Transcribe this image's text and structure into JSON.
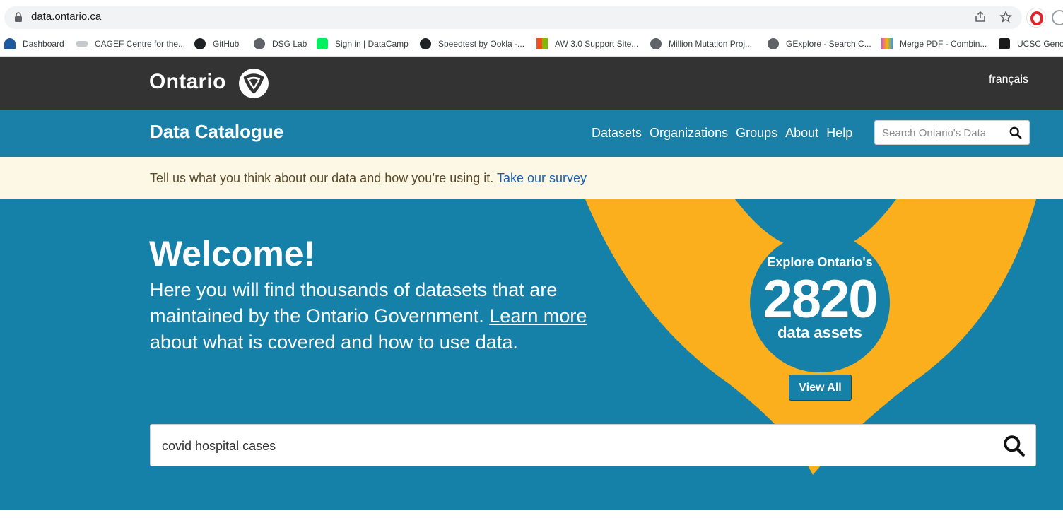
{
  "browser": {
    "url": "data.ontario.ca",
    "bookmarks": [
      {
        "label": "Dashboard",
        "icon": "tree-icon",
        "color": "#1f5b9c"
      },
      {
        "label": "CAGEF Centre for the...",
        "icon": "cagef-icon",
        "color": "#9aa0a6"
      },
      {
        "label": "GitHub",
        "icon": "github-icon",
        "color": "#202124"
      },
      {
        "label": "DSG Lab",
        "icon": "globe-icon",
        "color": "#5f6368"
      },
      {
        "label": "Sign in | DataCamp",
        "icon": "datacamp-icon",
        "color": "#03ef62"
      },
      {
        "label": "Speedtest by Ookla -...",
        "icon": "speedtest-icon",
        "color": "#202124"
      },
      {
        "label": "AW 3.0 Support Site...",
        "icon": "microsoft-icon",
        "color": "#f25022"
      },
      {
        "label": "Million Mutation Proj...",
        "icon": "globe-icon",
        "color": "#5f6368"
      },
      {
        "label": "GExplore - Search C...",
        "icon": "globe-icon",
        "color": "#5f6368"
      },
      {
        "label": "Merge PDF - Combin...",
        "icon": "pdf-icon",
        "color": "#e34bd0"
      },
      {
        "label": "UCSC Genor",
        "icon": "ucsc-icon",
        "color": "#1b1b1b"
      }
    ]
  },
  "header": {
    "logo_text": "Ontario",
    "language": "français"
  },
  "catalogue": {
    "title": "Data Catalogue",
    "nav": [
      "Datasets",
      "Organizations",
      "Groups",
      "About",
      "Help"
    ],
    "search_placeholder": "Search Ontario's Data"
  },
  "survey": {
    "text": "Tell us what you think about our data and how you’re using it.",
    "link": "Take our survey"
  },
  "hero": {
    "welcome": "Welcome!",
    "intro_before": "Here you will find thousands of datasets that are maintained by the Ontario Government.",
    "intro_link": "Learn more",
    "intro_after": "about what is covered and how to use data.",
    "explore_top": "Explore Ontario's",
    "explore_count": "2820",
    "explore_bottom": "data assets",
    "view_all": "View All",
    "search_value": "covid hospital cases"
  },
  "colors": {
    "dark_header": "#333333",
    "catalogue_blue": "#1b80a8",
    "hero_blue": "#1580a8",
    "survey_bg": "#fdf8e6",
    "trillium_gold": "#fbaf1d"
  }
}
